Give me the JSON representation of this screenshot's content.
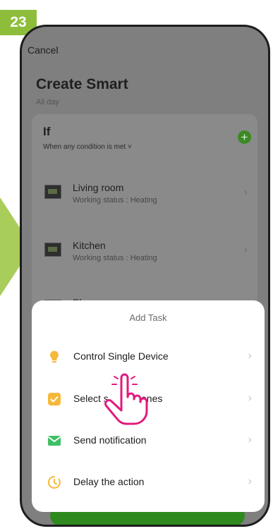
{
  "step_badge": "23",
  "header": {
    "cancel_label": "Cancel",
    "title": "Create Smart",
    "subtitle": "All day"
  },
  "condition": {
    "title": "If",
    "mode_label": "When any condition is met ˅"
  },
  "devices": [
    {
      "name": "Living room",
      "status": "Working status : Heating"
    },
    {
      "name": "Kitchen",
      "status": "Working status : Heating"
    },
    {
      "name": "Play room",
      "status": ""
    }
  ],
  "add_task_sheet": {
    "title": "Add Task",
    "items": [
      {
        "label": "Control Single Device",
        "icon": "lightbulb-icon",
        "color": "#f6b83a"
      },
      {
        "label": "Select s",
        "label_after_cursor": "enes",
        "icon": "checkbox-icon",
        "color": "#f6b83a"
      },
      {
        "label": "Send notification",
        "icon": "envelope-icon",
        "color": "#3fbf65"
      },
      {
        "label": "Delay the action",
        "icon": "clock-icon",
        "color": "#f6b83a"
      }
    ]
  },
  "colors": {
    "brand_green": "#8ebd3c",
    "accent_orange": "#f6b83a",
    "hand_pink": "#e21a7d"
  }
}
